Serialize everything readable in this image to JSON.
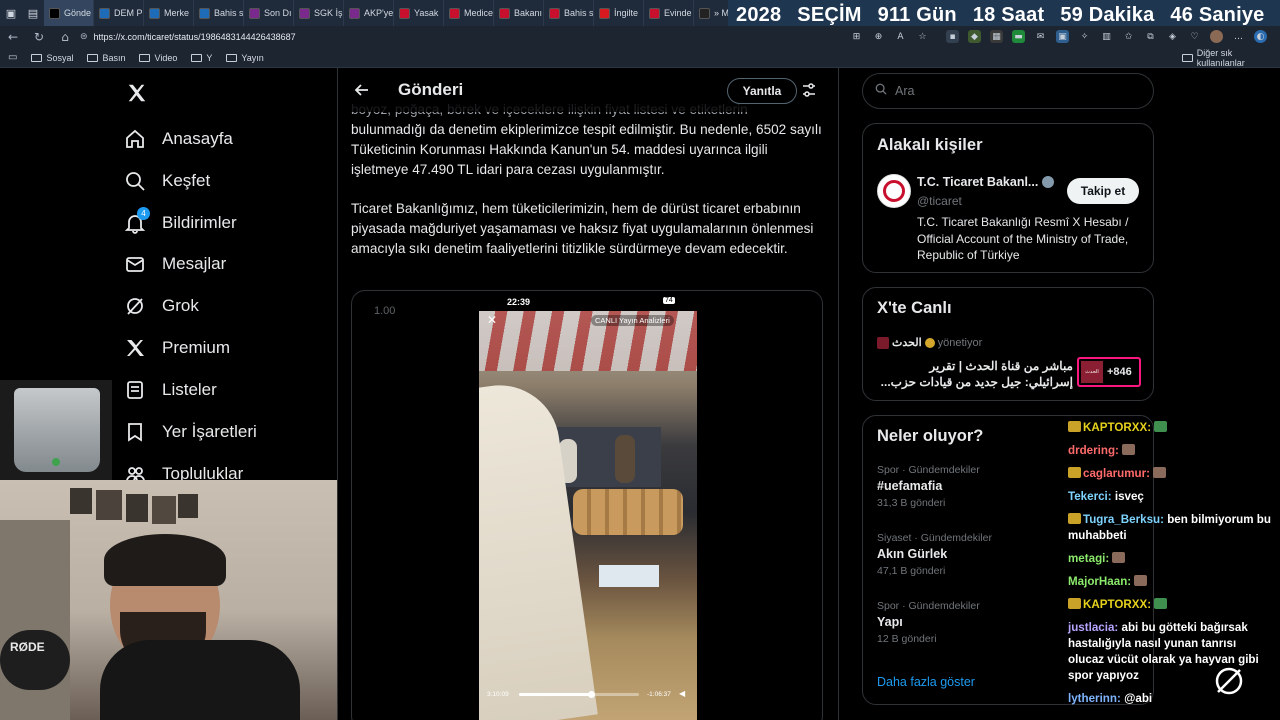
{
  "browser": {
    "tabs": [
      {
        "label": "Gönde",
        "icon": "x-icon",
        "color": "#000000"
      },
      {
        "label": "DEM P",
        "icon": "t24-icon",
        "color": "#1e6bb8"
      },
      {
        "label": "Merke",
        "icon": "t24-icon",
        "color": "#1e6bb8"
      },
      {
        "label": "Bahis s",
        "icon": "t24-icon",
        "color": "#1e6bb8"
      },
      {
        "label": "Son Dı",
        "icon": "h-icon",
        "color": "#7a2a8c"
      },
      {
        "label": "SGK İşl",
        "icon": "h-icon",
        "color": "#7a2a8c"
      },
      {
        "label": "AKP'ye",
        "icon": "h-icon",
        "color": "#7a2a8c"
      },
      {
        "label": "Yasak",
        "icon": "news-icon",
        "color": "#c8102e"
      },
      {
        "label": "Medice",
        "icon": "news-icon",
        "color": "#c8102e"
      },
      {
        "label": "Bakanı",
        "icon": "news-icon",
        "color": "#c8102e"
      },
      {
        "label": "Bahis s",
        "icon": "news-icon",
        "color": "#c8102e"
      },
      {
        "label": "İngilte",
        "icon": "t-icon",
        "color": "#d71920"
      },
      {
        "label": "Evinde",
        "icon": "news-icon",
        "color": "#c8102e"
      },
      {
        "label": "» Muh",
        "icon": "10-icon",
        "color": "#222222"
      }
    ],
    "url": "https://x.com/ticaret/status/1986483144426438687",
    "bookmarks": [
      "Sosyal",
      "Basın",
      "Video",
      "Y",
      "Yayın"
    ],
    "other_bookmarks": "Diğer sık kullanılanlar"
  },
  "countdown": {
    "year": "2028",
    "label": "SEÇİM",
    "days": "911 Gün",
    "hours": "18 Saat",
    "minutes": "59 Dakika",
    "seconds": "46 Saniye"
  },
  "sidebar": {
    "items": [
      {
        "label": "Anasayfa",
        "icon": "home-icon"
      },
      {
        "label": "Keşfet",
        "icon": "search-icon"
      },
      {
        "label": "Bildirimler",
        "icon": "bell-icon"
      },
      {
        "label": "Mesajlar",
        "icon": "mail-icon"
      },
      {
        "label": "Grok",
        "icon": "grok-icon"
      },
      {
        "label": "Premium",
        "icon": "x-logo-icon"
      },
      {
        "label": "Listeler",
        "icon": "list-icon"
      },
      {
        "label": "Yer İşaretleri",
        "icon": "bookmark-icon"
      },
      {
        "label": "Topluluklar",
        "icon": "people-icon"
      }
    ],
    "notification_count": "4"
  },
  "post": {
    "header_title": "Gönderi",
    "reply_button": "Yanıtla",
    "paragraph_partial": "boyoz, poğaça, börek ve içeceklere ilişkin fiyat listesi ve etiketlerin",
    "paragraph1": "bulunmadığı da denetim ekiplerimizce tespit edilmiştir. Bu nedenle, 6502 sayılı Tüketicinin Korunması Hakkında Kanun'un 54. maddesi uyarınca ilgili işletmeye 47.490 TL idari para cezası uygulanmıştır.",
    "paragraph2": "Ticaret Bakanlığımız, hem tüketicilerimizin, hem de dürüst ticaret erbabının piyasada mağduriyet yaşamaması ve haksız fiyat uygulamalarının önlenmesi amacıyla sıkı denetim faaliyetlerini titizlikle sürdürmeye devam edecektir.",
    "video": {
      "speed": "1.00",
      "status_time": "22:39",
      "battery": "74",
      "live_label": "CANLI Yayın Analizleri",
      "elapsed": "3:10:09",
      "remaining": "-1:06:37",
      "progress": 0.6
    }
  },
  "search": {
    "placeholder": "Ara"
  },
  "related": {
    "title": "Alakalı kişiler",
    "name": "T.C. Ticaret Bakanl...",
    "handle": "@ticaret",
    "bio": "T.C. Ticaret Bakanlığı Resmî X Hesabı / Official Account of the Ministry of Trade, Republic of Türkiye",
    "follow_button": "Takip et"
  },
  "live": {
    "title": "X'te Canlı",
    "host": "الحدث",
    "host_status": "yönetiyor",
    "text_line1": "مباشر من قناة الحدث | تقرير",
    "text_line2": "إسرائيلي: جيل جديد من قيادات حزب...",
    "listener_count": "+846",
    "thumb_label": "الحدث"
  },
  "trends": {
    "title": "Neler oluyor?",
    "items": [
      {
        "context": "Spor · Gündemdekiler",
        "name": "#uefamafia",
        "count": "31,3 B gönderi"
      },
      {
        "context": "Siyaset · Gündemdekiler",
        "name": "Akın Gürlek",
        "count": "47,1 B gönderi"
      },
      {
        "context": "Spor · Gündemdekiler",
        "name": "Yapı",
        "count": "12 B gönderi"
      }
    ],
    "show_more": "Daha fazla göster"
  },
  "chat": [
    {
      "user": "KAPTORXX:",
      "text": "",
      "color": "#e6d21c"
    },
    {
      "user": "drdering:",
      "text": "",
      "color": "#ff6b6b"
    },
    {
      "user": "caglarumur:",
      "text": "",
      "color": "#ff6b6b"
    },
    {
      "user": "Tekerci:",
      "text": "isveç",
      "color": "#7fd4ff"
    },
    {
      "user": "Tugra_Berksu:",
      "text": "ben bilmiyorum bu muhabbeti",
      "color": "#7fd4ff"
    },
    {
      "user": "metagi:",
      "text": "",
      "color": "#8bea6b"
    },
    {
      "user": "MajorHaan:",
      "text": "",
      "color": "#8bea6b"
    },
    {
      "user": "KAPTORXX:",
      "text": "",
      "color": "#e6d21c"
    },
    {
      "user": "justlacia:",
      "text": "abi bu götteki bağırsak hastalığıyla nasıl yunan tanrısı olucaz vücüt olarak ya hayvan gibi spor yapıyoz",
      "color": "#b7a4ff"
    },
    {
      "user": "lytherinn:",
      "text": "@abi",
      "color": "#7fb4ff"
    }
  ],
  "webcam": {
    "mic_brand": "RØDE"
  },
  "colors": {
    "accent": "#1d9bf0",
    "background": "#000000",
    "border": "#2f3336"
  }
}
